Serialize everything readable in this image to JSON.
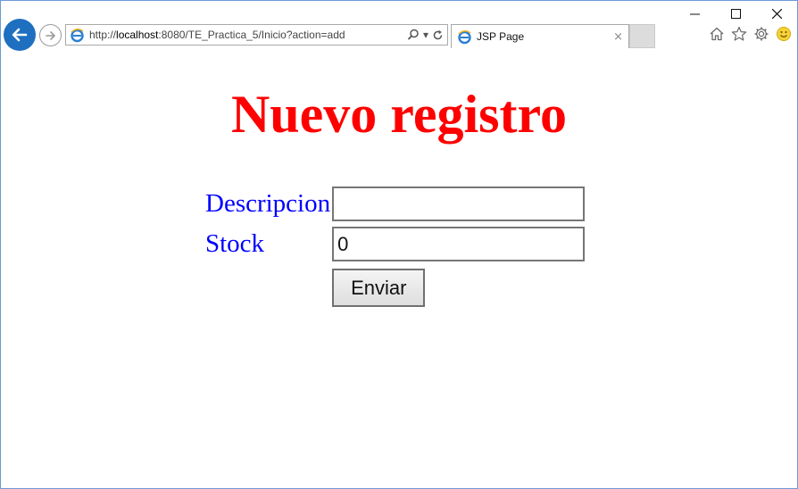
{
  "browser": {
    "url": {
      "prefix": "http://",
      "host": "localhost",
      "rest": ":8080/TE_Practica_5/Inicio?action=add"
    },
    "tab_title": "JSP Page",
    "tab_close": "×",
    "window_controls": {
      "minimize": "—",
      "maximize": "☐",
      "close": "✕"
    },
    "address_tools": {
      "search": "⌕",
      "dropdown": "▾",
      "refresh": "↻"
    },
    "accent_color": "#1e6fc0"
  },
  "page": {
    "heading": "Nuevo registro",
    "heading_color": "#ff0000",
    "label_color": "#0000ff",
    "form": {
      "descripcion_label": "Descripcion",
      "descripcion_value": "",
      "stock_label": "Stock",
      "stock_value": "0",
      "submit_label": "Enviar"
    }
  }
}
